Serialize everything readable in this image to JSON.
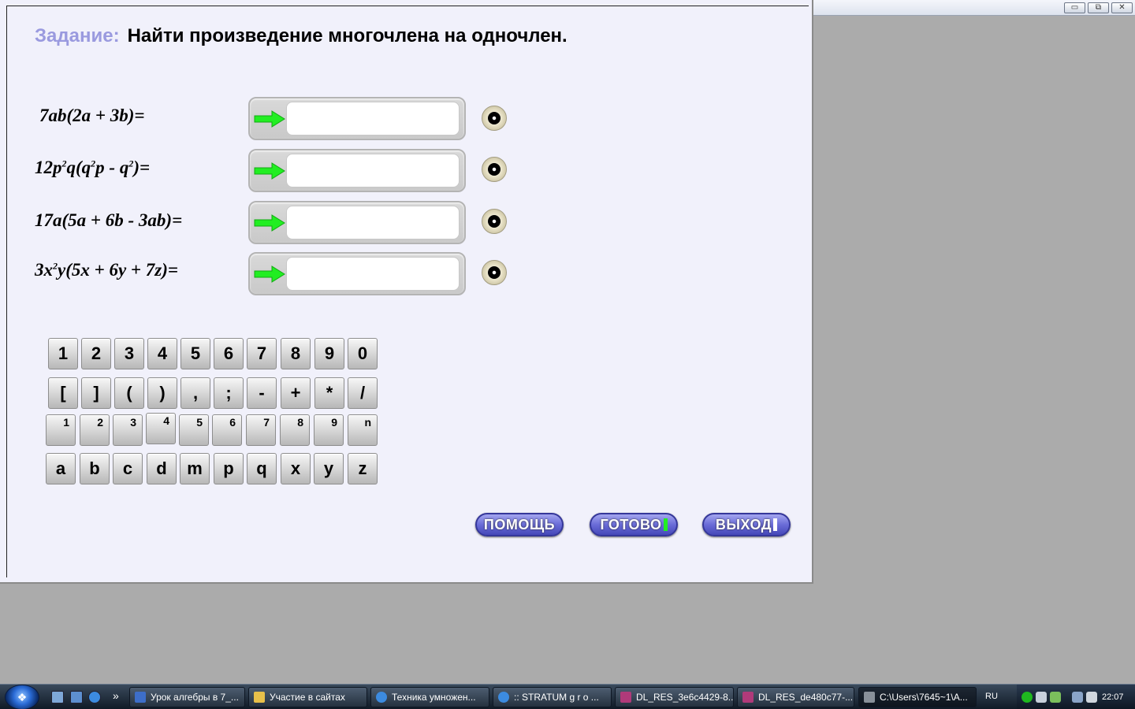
{
  "window_controls": {
    "minimize": "▭",
    "restore": "⧉",
    "close": "✕"
  },
  "task": {
    "label": "Задание:",
    "text": "Найти произведение многочлена на одночлен."
  },
  "exercises": [
    {
      "expr_a": "7ab(2a + 3b)=",
      "answer": ""
    },
    {
      "expr_a": "12p",
      "sup_1": "2",
      "expr_b": "q(q",
      "sup_2": "2",
      "expr_c": "p - q",
      "sup_3": "2",
      "expr_d": ")=",
      "answer": ""
    },
    {
      "expr_a": "17a(5a + 6b - 3ab)=",
      "answer": ""
    },
    {
      "expr_a": "3x",
      "sup_1": "2",
      "expr_b": "y(5x + 6y + 7z)=",
      "answer": ""
    }
  ],
  "keypad": {
    "digits": [
      "1",
      "2",
      "3",
      "4",
      "5",
      "6",
      "7",
      "8",
      "9",
      "0"
    ],
    "symbols": [
      "[",
      "]",
      "(",
      ")",
      ",",
      ";",
      "-",
      "+",
      "*",
      "/"
    ],
    "exponents": [
      "1",
      "2",
      "3",
      "4",
      "5",
      "6",
      "7",
      "8",
      "9",
      "n"
    ],
    "letters": [
      "a",
      "b",
      "c",
      "d",
      "m",
      "p",
      "q",
      "x",
      "y",
      "z"
    ]
  },
  "buttons": {
    "help": "ПОМОЩЬ",
    "done": "ГОТОВО",
    "exit": "ВЫХОД"
  },
  "taskbar": {
    "items": [
      "Урок алгебры в 7_...",
      "Участие в сайтах",
      "Техника умножен...",
      ":: STRATUM g r o ...",
      "DL_RES_3e6c4429-8...",
      "DL_RES_de480c77-...",
      "C:\\Users\\7645~1\\A..."
    ],
    "overflow": "»",
    "language": "RU",
    "time": "22:07"
  },
  "colors": {
    "panel_bg": "#f1f1fb",
    "task_label": "#9a9adf",
    "arrow_green": "#22ee22",
    "pill_blue": "#6a6cd8"
  }
}
